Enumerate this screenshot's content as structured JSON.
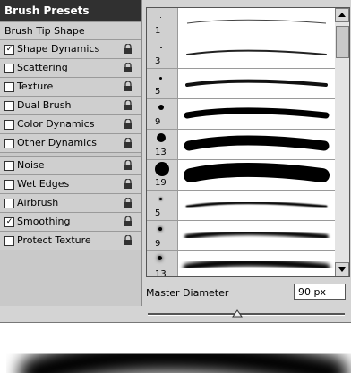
{
  "panel": {
    "title": "Brush Presets",
    "tip_shape": "Brush Tip Shape",
    "options": [
      {
        "label": "Shape Dynamics",
        "checked": true
      },
      {
        "label": "Scattering",
        "checked": false
      },
      {
        "label": "Texture",
        "checked": false
      },
      {
        "label": "Dual Brush",
        "checked": false
      },
      {
        "label": "Color Dynamics",
        "checked": false
      },
      {
        "label": "Other Dynamics",
        "checked": false
      }
    ],
    "options2": [
      {
        "label": "Noise",
        "checked": false
      },
      {
        "label": "Wet Edges",
        "checked": false
      },
      {
        "label": "Airbrush",
        "checked": false
      },
      {
        "label": "Smoothing",
        "checked": true
      },
      {
        "label": "Protect Texture",
        "checked": false
      }
    ]
  },
  "brushes": [
    {
      "size": "1"
    },
    {
      "size": "3"
    },
    {
      "size": "5"
    },
    {
      "size": "9"
    },
    {
      "size": "13"
    },
    {
      "size": "19"
    },
    {
      "size": "5"
    },
    {
      "size": "9"
    },
    {
      "size": "13"
    }
  ],
  "master_diameter": {
    "label": "Master Diameter",
    "value": "90 px",
    "fraction": 0.45
  },
  "icons": {
    "lock": "lock-icon",
    "check": "✓"
  }
}
